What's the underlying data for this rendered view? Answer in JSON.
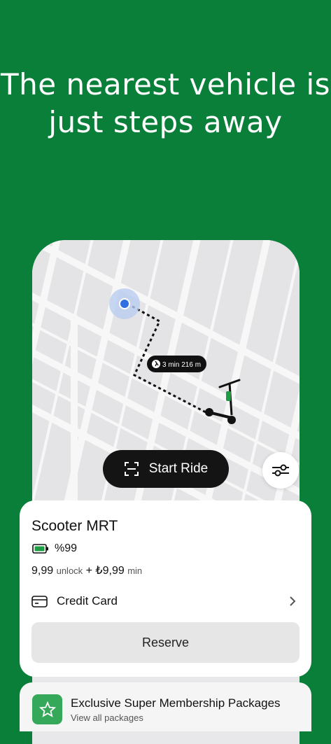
{
  "headline": "The nearest vehicle is just steps away",
  "map": {
    "route_label": "3 min 216 m"
  },
  "actions": {
    "start_ride": "Start Ride"
  },
  "vehicle": {
    "name": "Scooter MRT",
    "battery": "%99",
    "unlock_price": "9,99",
    "unlock_label": "unlock",
    "plus": "+",
    "minute_price": "₺9,99",
    "minute_label": "min",
    "payment_method": "Credit Card",
    "reserve_label": "Reserve"
  },
  "promo": {
    "title": "Exclusive Super Membership Packages",
    "subtitle": "View all packages"
  },
  "colors": {
    "brand_green": "#0a7f3a",
    "user_dot": "#2f6fe0",
    "battery_green": "#1f9d45"
  }
}
